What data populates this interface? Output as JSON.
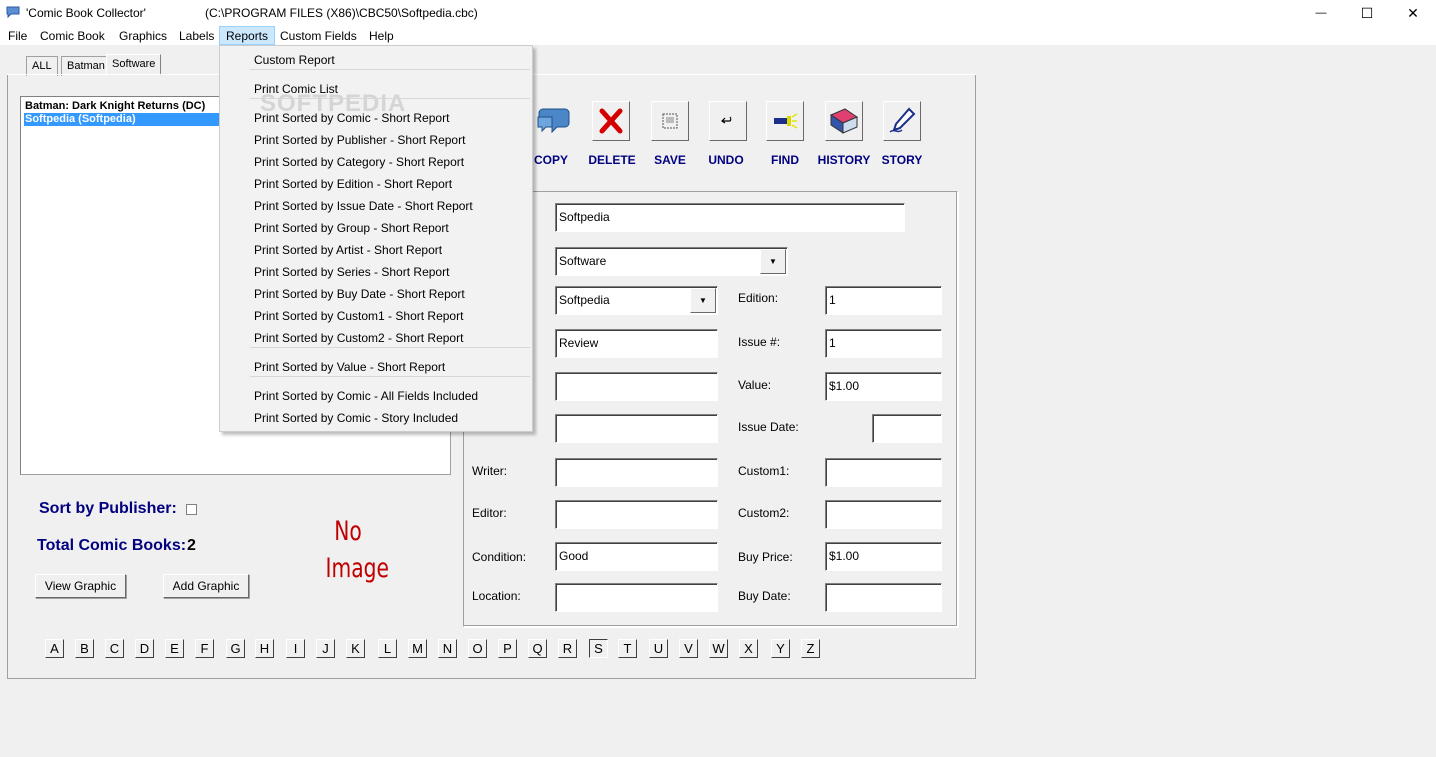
{
  "window": {
    "app_title": "'Comic Book Collector'",
    "file_path": "(C:\\PROGRAM FILES (X86)\\CBC50\\Softpedia.cbc)",
    "minimize_glyph": "—",
    "maximize_glyph": "☐",
    "close_glyph": "✕"
  },
  "menu": [
    "File",
    "Comic Book",
    "Graphics",
    "Labels",
    "Reports",
    "Custom Fields",
    "Help"
  ],
  "tabs": [
    "ALL",
    "Batman",
    "Software"
  ],
  "comic_list": [
    "Batman: Dark Knight Returns (DC)",
    "Softpedia (Softpedia)"
  ],
  "sort_by_publisher_label": "Sort by Publisher:",
  "total_label": "Total Comic Books:",
  "total_count": "2",
  "view_graphic_label": "View Graphic",
  "add_graphic_label": "Add Graphic",
  "no_image_line1": "No",
  "no_image_line2": "Image",
  "letters": [
    "A",
    "B",
    "C",
    "D",
    "E",
    "F",
    "G",
    "H",
    "I",
    "J",
    "K",
    "L",
    "M",
    "N",
    "O",
    "P",
    "Q",
    "R",
    "S",
    "T",
    "U",
    "V",
    "W",
    "X",
    "Y",
    "Z"
  ],
  "selected_letter": "S",
  "toolbar": [
    "COPY",
    "DELETE",
    "SAVE",
    "UNDO",
    "FIND",
    "HISTORY",
    "STORY"
  ],
  "form": {
    "title_value": "Softpedia",
    "category_value": "Software",
    "publisher_value": "Softpedia",
    "group_value": "Review",
    "edition_label": "Edition:",
    "edition_value": "1",
    "issue_label": "Issue #:",
    "issue_value": "1",
    "value_label": "Value:",
    "value_value": "$1.00",
    "issue_date_label": "Issue Date:",
    "writer_label": "Writer:",
    "editor_label": "Editor:",
    "condition_label": "Condition:",
    "condition_value": "Good",
    "location_label": "Location:",
    "custom1_label": "Custom1:",
    "custom2_label": "Custom2:",
    "buy_price_label": "Buy Price:",
    "buy_price_value": "$1.00",
    "buy_date_label": "Buy Date:"
  },
  "reports_menu": {
    "group1": [
      "Custom Report"
    ],
    "group2": [
      "Print Comic List"
    ],
    "group3": [
      "Print Sorted by Comic - Short Report",
      "Print Sorted by Publisher - Short Report",
      "Print Sorted by Category - Short Report",
      "Print Sorted by Edition - Short Report",
      "Print Sorted by Issue Date - Short Report",
      "Print Sorted by Group - Short Report",
      "Print Sorted by Artist - Short Report",
      "Print Sorted by Series - Short Report",
      "Print Sorted by Buy Date - Short Report",
      "Print Sorted by Custom1 - Short Report",
      "Print Sorted by Custom2 - Short Report"
    ],
    "group4": [
      "Print Sorted by Value - Short Report"
    ],
    "group5": [
      "Print Sorted by Comic - All Fields Included",
      "Print Sorted by Comic - Story Included"
    ]
  },
  "watermark": "SOFTPEDIA"
}
